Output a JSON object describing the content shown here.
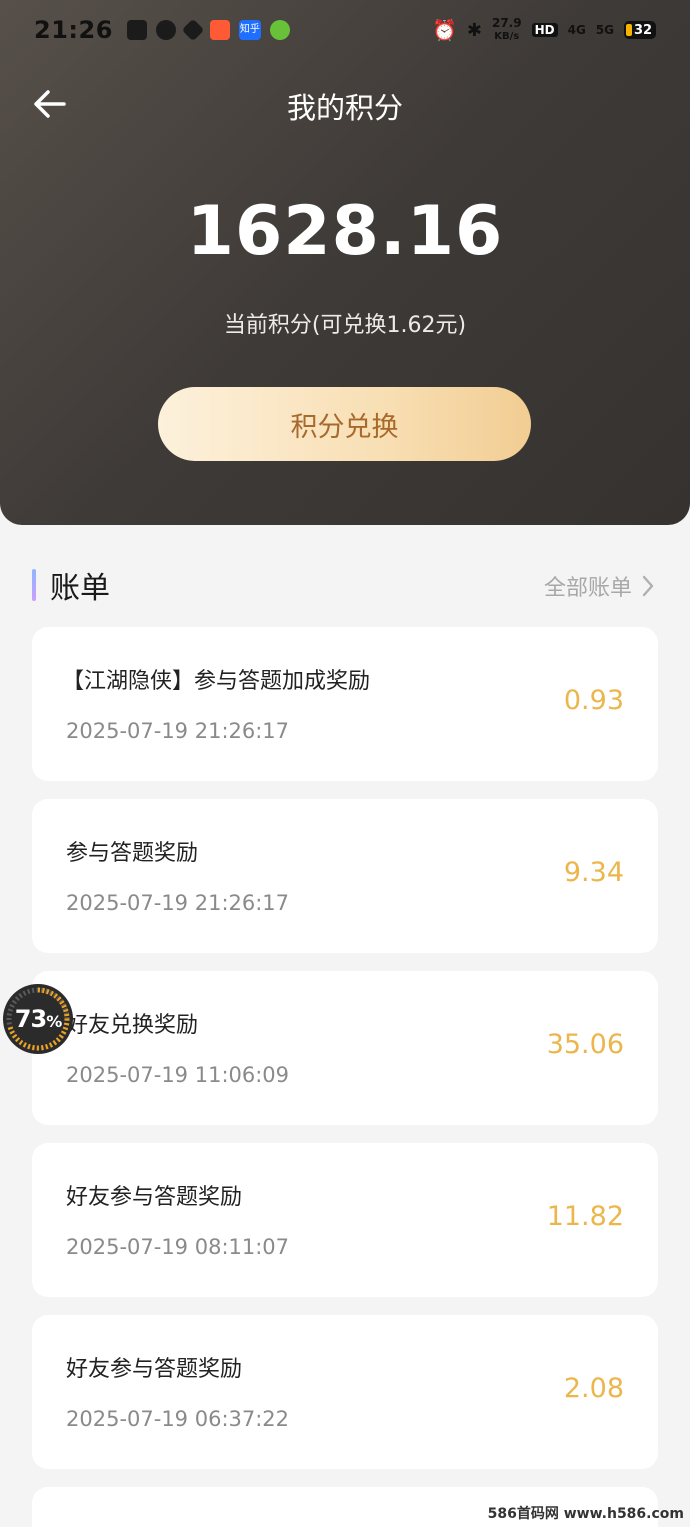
{
  "status_bar": {
    "time": "21:26",
    "app_icons": [
      "tv-icon",
      "sync-icon",
      "vpn-icon",
      "app-red-icon",
      "zhihu-icon",
      "app-green-icon"
    ],
    "zhihu_label": "知乎",
    "speed_top": "27.9",
    "speed_bottom": "KB/s",
    "hd": "HD",
    "net1": "4G",
    "net2": "5G",
    "battery": "32"
  },
  "header": {
    "title": "我的积分",
    "points": "1628.16",
    "points_caption": "当前积分(可兑换1.62元)",
    "exchange_label": "积分兑换"
  },
  "bills": {
    "title": "账单",
    "more_label": "全部账单",
    "items": [
      {
        "name": "【江湖隐侠】参与答题加成奖励",
        "time": "2025-07-19 21:26:17",
        "amount": "0.93"
      },
      {
        "name": "参与答题奖励",
        "time": "2025-07-19 21:26:17",
        "amount": "9.34"
      },
      {
        "name": "好友兑换奖励",
        "time": "2025-07-19 11:06:09",
        "amount": "35.06"
      },
      {
        "name": "好友参与答题奖励",
        "time": "2025-07-19 08:11:07",
        "amount": "11.82"
      },
      {
        "name": "好友参与答题奖励",
        "time": "2025-07-19 06:37:22",
        "amount": "2.08"
      }
    ]
  },
  "overlay": {
    "progress_value": "73",
    "progress_unit": "%",
    "progress_fraction": 0.73
  },
  "watermark": "586首码网 www.h586.com",
  "colors": {
    "accent_amount": "#ebb64b",
    "button_text": "#a86a2c",
    "header_bg": "#3e3a37"
  }
}
